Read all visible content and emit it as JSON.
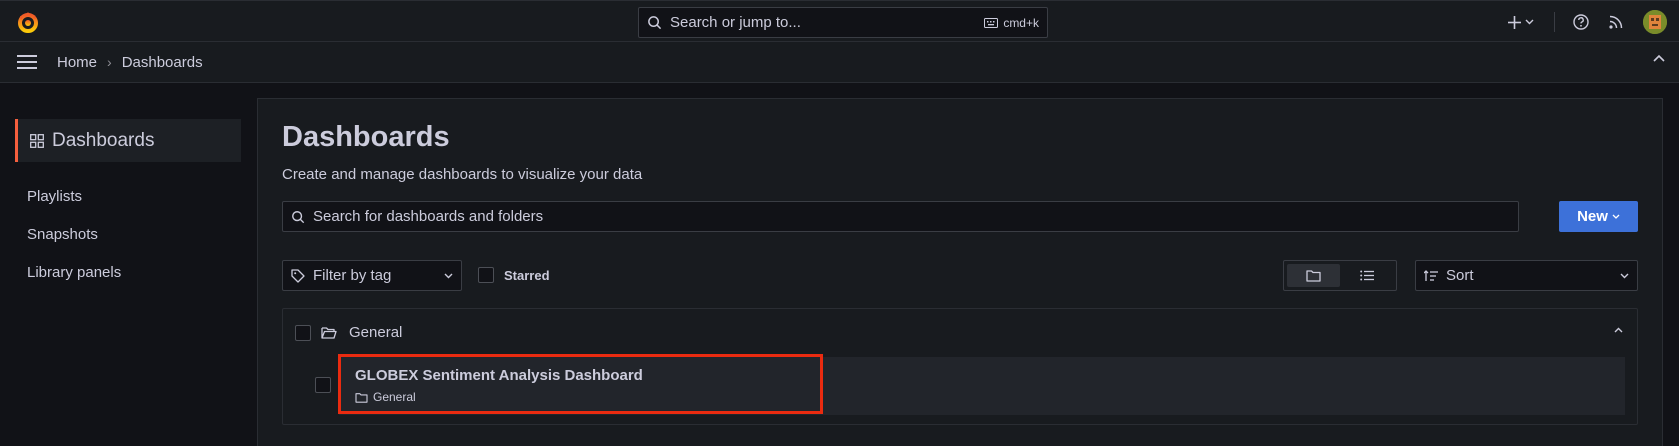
{
  "topbar": {
    "search_placeholder": "Search or jump to...",
    "shortcut": "cmd+k",
    "plus_label": "+",
    "accent_color": "#f55f3e"
  },
  "breadcrumb": {
    "home": "Home",
    "separator": "›",
    "current": "Dashboards"
  },
  "sidebar": {
    "header": "Dashboards",
    "items": [
      {
        "label": "Playlists"
      },
      {
        "label": "Snapshots"
      },
      {
        "label": "Library panels"
      }
    ]
  },
  "main": {
    "title": "Dashboards",
    "subtitle": "Create and manage dashboards to visualize your data",
    "search_placeholder": "Search for dashboards and folders",
    "new_button": "New",
    "filter_tag_placeholder": "Filter by tag",
    "starred_label": "Starred",
    "sort_placeholder": "Sort",
    "folder": {
      "name": "General",
      "dashboards": [
        {
          "title": "GLOBEX Sentiment Analysis Dashboard",
          "location": "General"
        }
      ]
    }
  },
  "colors": {
    "primary_button": "#3d71d9",
    "highlight_box": "#ea2b10",
    "active_marker": "#f55f3e"
  }
}
